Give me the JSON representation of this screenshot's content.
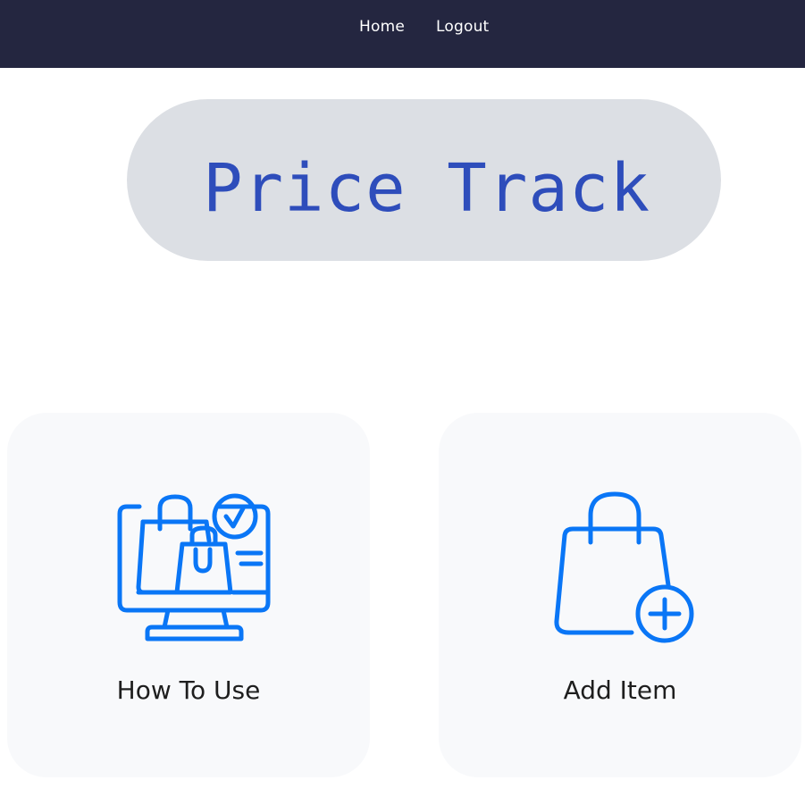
{
  "nav": {
    "home_label": "Home",
    "logout_label": "Logout"
  },
  "header": {
    "title": "Price Track"
  },
  "cards": [
    {
      "label": "How To Use",
      "icon": "computer-shopping-bags-check-icon"
    },
    {
      "label": "Add Item",
      "icon": "shopping-bag-add-icon"
    }
  ],
  "colors": {
    "navbar_bg": "#242640",
    "title_pill_bg": "#dcdfe4",
    "title_text": "#2e4dbb",
    "icon_blue": "#0a76f6",
    "card_bg": "#f8f9fb"
  }
}
